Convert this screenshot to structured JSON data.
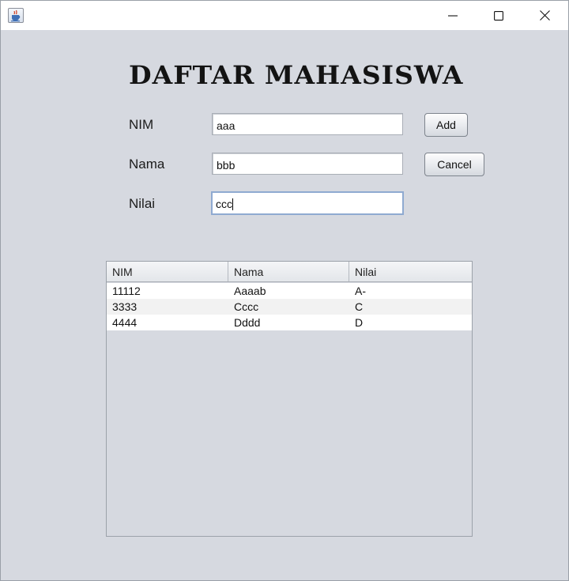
{
  "window": {
    "icon": "java-cup-icon",
    "controls": [
      "minimize-icon",
      "maximize-icon",
      "close-icon"
    ]
  },
  "form": {
    "heading": "DAFTAR MAHASISWA",
    "nim_label": "NIM",
    "nama_label": "Nama",
    "nilai_label": "Nilai",
    "nim_value": "aaa",
    "nama_value": "bbb",
    "nilai_value": "ccc",
    "add_label": "Add",
    "cancel_label": "Cancel"
  },
  "table": {
    "columns": [
      "NIM",
      "Nama",
      "Nilai"
    ],
    "rows": [
      [
        "11112",
        "Aaaab",
        "A-"
      ],
      [
        "3333",
        "Cccc",
        "C"
      ],
      [
        "4444",
        "Dddd",
        "D"
      ]
    ]
  },
  "colors": {
    "background": "#d6d9e0",
    "focus_border": "#8faad1"
  }
}
